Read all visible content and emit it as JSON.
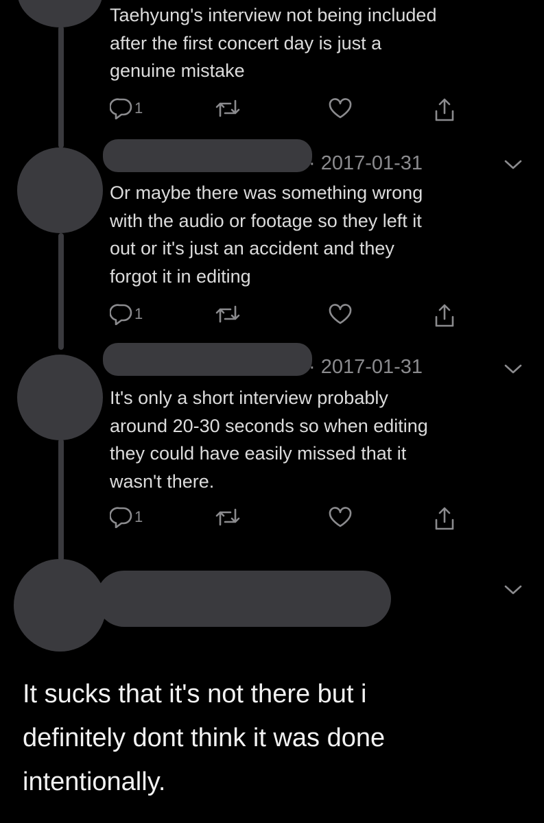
{
  "tweets": [
    {
      "text": "Taehyung's interview not being included\nafter the first concert day is just a\ngenuine mistake",
      "actions": {
        "reply_icon": "reply-icon",
        "reply_count": "1",
        "retweet_icon": "retweet-icon",
        "like_icon": "heart-icon",
        "share_icon": "share-icon"
      }
    },
    {
      "date": "2017-01-31",
      "text": "Or maybe there was something wrong\nwith the audio or footage so they left it\nout or it's just an accident and they\nforgot it in editing",
      "actions": {
        "reply_icon": "reply-icon",
        "reply_count": "1",
        "retweet_icon": "retweet-icon",
        "like_icon": "heart-icon",
        "share_icon": "share-icon"
      }
    },
    {
      "date": "2017-01-31",
      "text": "It's only a short interview probably\naround 20-30 seconds so when editing\nthey could have easily missed that it\nwasn't there.",
      "actions": {
        "reply_icon": "reply-icon",
        "reply_count": "1",
        "retweet_icon": "retweet-icon",
        "like_icon": "heart-icon",
        "share_icon": "share-icon"
      }
    }
  ],
  "caption": "It sucks that it's not there but i\ndefinitely dont think it was done\nintentionally.",
  "colors": {
    "background": "#000000",
    "redaction": "#3a3a3e",
    "muted": "#8b8b8e",
    "text": "#dcdcdc"
  }
}
